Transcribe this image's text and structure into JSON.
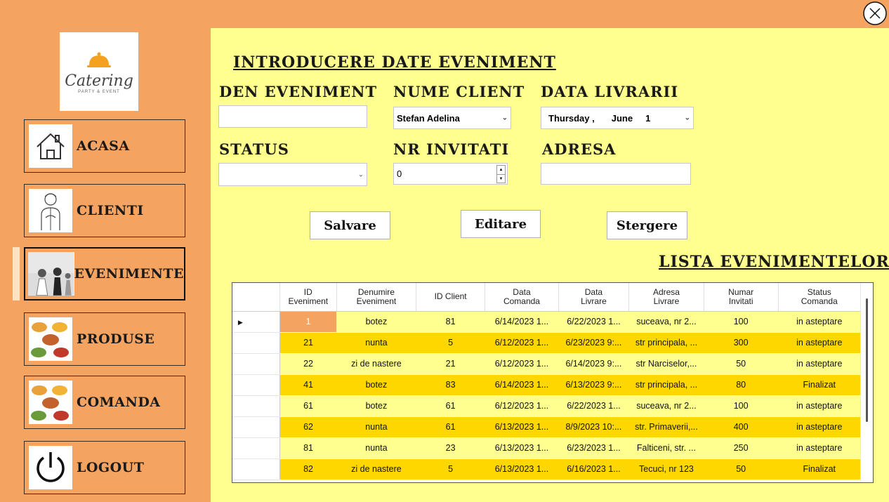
{
  "window": {
    "close_icon": "close-circle-icon"
  },
  "logo": {
    "text": "Catering",
    "subtext": "PARTY & EVENT",
    "icon": "cloche-icon"
  },
  "nav": [
    {
      "label": "ACASA",
      "icon": "home-icon"
    },
    {
      "label": "CLIENTI",
      "icon": "waiter-icon"
    },
    {
      "label": "EVENIMENTE",
      "icon": "wedding-photo-icon"
    },
    {
      "label": "PRODUSE",
      "icon": "food-plates-icon"
    },
    {
      "label": "COMANDA",
      "icon": "food-plates-icon"
    },
    {
      "label": "LOGOUT",
      "icon": "power-icon"
    }
  ],
  "form": {
    "title": "INTRODUCERE DATE EVENIMENT",
    "den_label": "DEN EVENIMENT",
    "den_value": "",
    "client_label": "NUME CLIENT",
    "client_value": "Stefan Adelina",
    "data_label": "DATA LIVRARII",
    "data_day": "Thursday ,",
    "data_month": "June",
    "data_num": "1",
    "status_label": "STATUS",
    "status_value": "",
    "invitati_label": "NR INVITATI",
    "invitati_value": "0",
    "adresa_label": "ADRESA",
    "adresa_value": ""
  },
  "buttons": {
    "save": "Salvare",
    "edit": "Editare",
    "delete": "Stergere"
  },
  "list_title": "LISTA EVENIMENTELOR",
  "table": {
    "headers": [
      [
        "ID",
        "Eveniment"
      ],
      [
        "Denumire",
        "Eveniment"
      ],
      [
        "ID Client",
        ""
      ],
      [
        "Data",
        "Comanda"
      ],
      [
        "Data",
        "Livrare"
      ],
      [
        "Adresa",
        "Livrare"
      ],
      [
        "Numar",
        "Invitati"
      ],
      [
        "Status",
        "Comanda"
      ]
    ],
    "rows": [
      [
        "1",
        "botez",
        "81",
        "6/14/2023 1...",
        "6/22/2023 1...",
        "suceava, nr 2...",
        "100",
        "in asteptare"
      ],
      [
        "21",
        "nunta",
        "5",
        "6/12/2023 1...",
        "6/23/2023 9:...",
        "str principala, ...",
        "300",
        "in asteptare"
      ],
      [
        "22",
        "zi de nastere",
        "21",
        "6/12/2023 1...",
        "6/14/2023 9:...",
        "str Narciselor,...",
        "50",
        "in asteptare"
      ],
      [
        "41",
        "botez",
        "83",
        "6/14/2023 1...",
        "6/13/2023 9:...",
        "str principala, ...",
        "80",
        "Finalizat"
      ],
      [
        "61",
        "botez",
        "61",
        "6/12/2023 1...",
        "6/22/2023 1...",
        "suceava, nr 2...",
        "100",
        "in asteptare"
      ],
      [
        "62",
        "nunta",
        "61",
        "6/13/2023 1...",
        "8/9/2023 10:...",
        "str. Primaverii,...",
        "400",
        "in asteptare"
      ],
      [
        "81",
        "nunta",
        "23",
        "6/13/2023 1...",
        "6/23/2023 1...",
        "Falticeni, str. ...",
        "250",
        "in asteptare"
      ],
      [
        "82",
        "zi de nastere",
        "5",
        "6/13/2023 1...",
        "6/16/2023 1...",
        "Tecuci, nr 123",
        "50",
        "Finalizat"
      ]
    ]
  }
}
